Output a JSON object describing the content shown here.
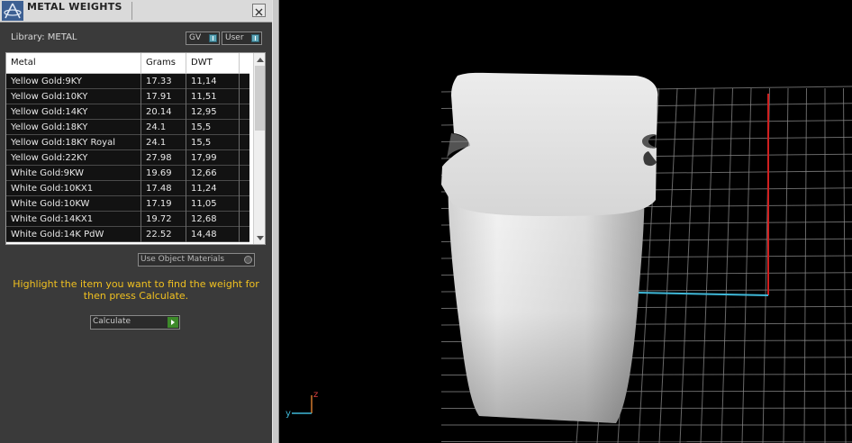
{
  "panel": {
    "title": "METAL WEIGHTS",
    "library_label": "Library: METAL",
    "toggle_gv": "GV",
    "toggle_user": "User",
    "columns": [
      "Metal",
      "Grams",
      "DWT"
    ],
    "rows": [
      {
        "metal": "Yellow Gold:9KY",
        "grams": "17.33",
        "dwt": "11,14"
      },
      {
        "metal": "Yellow Gold:10KY",
        "grams": "17.91",
        "dwt": "11,51"
      },
      {
        "metal": "Yellow Gold:14KY",
        "grams": "20.14",
        "dwt": "12,95"
      },
      {
        "metal": "Yellow Gold:18KY",
        "grams": "24.1",
        "dwt": "15,5"
      },
      {
        "metal": "Yellow Gold:18KY Royal",
        "grams": "24.1",
        "dwt": "15,5"
      },
      {
        "metal": "Yellow Gold:22KY",
        "grams": "27.98",
        "dwt": "17,99"
      },
      {
        "metal": "White Gold:9KW",
        "grams": "19.69",
        "dwt": "12,66"
      },
      {
        "metal": "White Gold:10KX1",
        "grams": "17.48",
        "dwt": "11,24"
      },
      {
        "metal": "White Gold:10KW",
        "grams": "17.19",
        "dwt": "11,05"
      },
      {
        "metal": "White Gold:14KX1",
        "grams": "19.72",
        "dwt": "12,68"
      },
      {
        "metal": "White Gold:14K PdW",
        "grams": "22.52",
        "dwt": "14,48"
      }
    ],
    "use_object_materials": "Use Object Materials",
    "hint": "Highlight the item you want to find the weight for then press Calculate.",
    "calculate_label": "Calculate"
  },
  "viewport": {
    "axis_z": "z",
    "axis_y": "y"
  },
  "colors": {
    "hint": "#f0c020",
    "grid": "#8a8a8a",
    "axis_red": "#d02020",
    "axis_cyan": "#3fb8d8"
  }
}
